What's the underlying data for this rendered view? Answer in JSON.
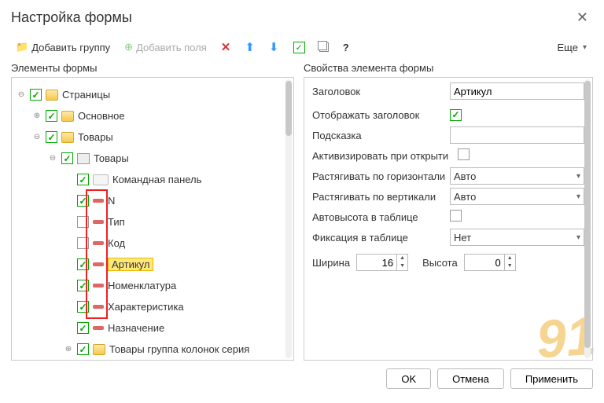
{
  "title": "Настройка формы",
  "toolbar": {
    "add_group": "Добавить группу",
    "add_fields": "Добавить поля",
    "more": "Еще"
  },
  "left_title": "Элементы формы",
  "right_title": "Свойства элемента формы",
  "tree": {
    "pages": "Страницы",
    "main": "Основное",
    "goods": "Товары",
    "goods_grid": "Товары",
    "cmd_panel": "Командная панель",
    "n": "N",
    "type": "Тип",
    "code": "Код",
    "article": "Артикул",
    "nomen": "Номенклатура",
    "charact": "Характеристика",
    "purpose": "Назначение",
    "goods_group": "Товары группа колонок серия"
  },
  "props": {
    "header": "Заголовок",
    "header_val": "Артикул",
    "show_header": "Отображать заголовок",
    "hint": "Подсказка",
    "hint_val": "",
    "activate": "Активизировать при открыти",
    "stretch_h": "Растягивать по горизонтали",
    "stretch_h_val": "Авто",
    "stretch_v": "Растягивать по вертикали",
    "stretch_v_val": "Авто",
    "autoheight": "Автовысота в таблице",
    "fixation": "Фиксация в таблице",
    "fixation_val": "Нет",
    "width": "Ширина",
    "width_val": "16",
    "height": "Высота",
    "height_val": "0"
  },
  "footer": {
    "ok": "OK",
    "cancel": "Отмена",
    "apply": "Применить"
  },
  "watermark": "91"
}
